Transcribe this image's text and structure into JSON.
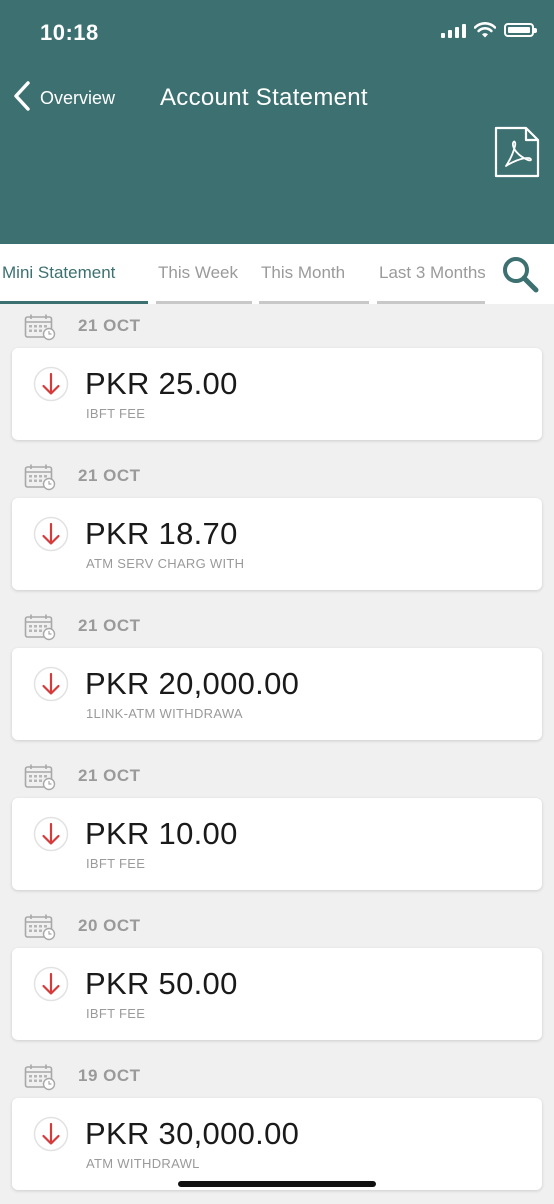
{
  "status_bar": {
    "time": "10:18"
  },
  "header": {
    "back_label": "Overview",
    "title": "Account Statement"
  },
  "tabs": [
    {
      "label": "Mini Statement"
    },
    {
      "label": "This Week"
    },
    {
      "label": "This Month"
    },
    {
      "label": "Last 3 Months"
    }
  ],
  "transactions": [
    {
      "date": "21 OCT",
      "amount": "PKR 25.00",
      "description": "IBFT FEE"
    },
    {
      "date": "21 OCT",
      "amount": "PKR 18.70",
      "description": "ATM SERV CHARG WITH"
    },
    {
      "date": "21 OCT",
      "amount": "PKR 20,000.00",
      "description": "1LINK-ATM WITHDRAWA"
    },
    {
      "date": "21 OCT",
      "amount": "PKR 10.00",
      "description": "IBFT FEE"
    },
    {
      "date": "20 OCT",
      "amount": "PKR 50.00",
      "description": "IBFT FEE"
    },
    {
      "date": "19 OCT",
      "amount": "PKR 30,000.00",
      "description": "ATM WITHDRAWL"
    }
  ],
  "colors": {
    "header": "#3d7071",
    "debit_arrow": "#d63b3b",
    "muted_text": "#9a9a9a"
  }
}
